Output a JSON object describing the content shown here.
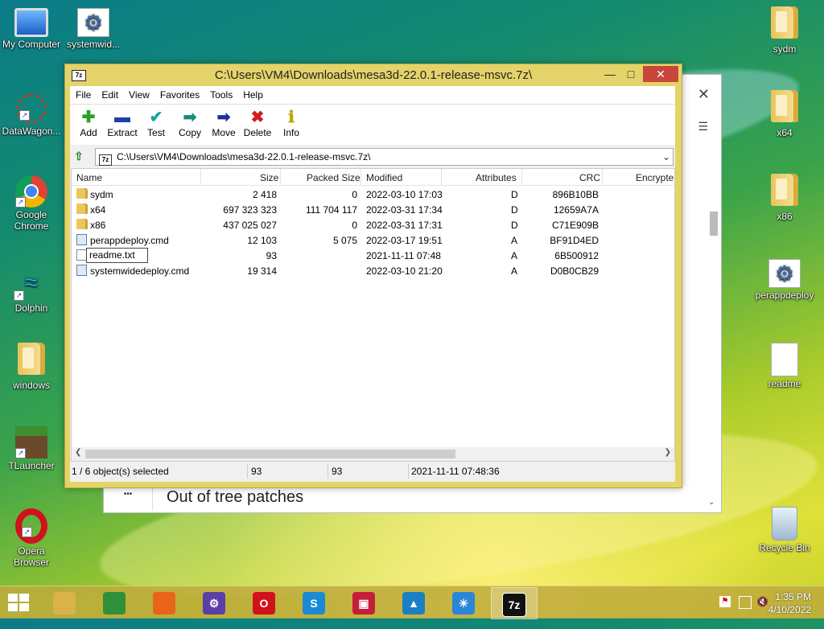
{
  "desktop": {
    "icons_left": [
      {
        "label": "My Computer",
        "icon": "computer-icon"
      },
      {
        "label": "systemwid...",
        "icon": "settings-file-icon"
      },
      {
        "label": "DataWagon...",
        "icon": "datawagon-icon"
      },
      {
        "label": "Google Chrome",
        "icon": "chrome-icon"
      },
      {
        "label": "Dolphin",
        "icon": "dolphin-icon"
      },
      {
        "label": "windows",
        "icon": "folder-icon"
      },
      {
        "label": "TLauncher",
        "icon": "minecraft-block-icon"
      },
      {
        "label": "Opera Browser",
        "icon": "opera-icon"
      }
    ],
    "icons_right": [
      {
        "label": "sydm",
        "icon": "folder-icon"
      },
      {
        "label": "x64",
        "icon": "folder-icon"
      },
      {
        "label": "x86",
        "icon": "folder-icon"
      },
      {
        "label": "perappdeploy",
        "icon": "settings-file-icon"
      },
      {
        "label": "readme",
        "icon": "text-file-icon"
      },
      {
        "label": "Recycle Bin",
        "icon": "recycle-bin-icon"
      }
    ]
  },
  "background_window": {
    "heading": "Out of tree patches",
    "more_glyph": "•••",
    "close_glyph": "✕",
    "menu_glyph": "☰"
  },
  "window": {
    "title": "C:\\Users\\VM4\\Downloads\\mesa3d-22.0.1-release-msvc.7z\\",
    "icon_label": "7z",
    "menu": [
      "File",
      "Edit",
      "View",
      "Favorites",
      "Tools",
      "Help"
    ],
    "toolbar": [
      {
        "label": "Add",
        "icon": "plus-icon",
        "glyph": "✚",
        "color": "#2aa02a"
      },
      {
        "label": "Extract",
        "icon": "minus-icon",
        "glyph": "▬",
        "color": "#1c3fa8"
      },
      {
        "label": "Test",
        "icon": "check-icon",
        "glyph": "✔",
        "color": "#1aa3a3"
      },
      {
        "label": "Copy",
        "icon": "copy-arrow-icon",
        "glyph": "➡",
        "color": "#1a8a7a"
      },
      {
        "label": "Move",
        "icon": "move-arrow-icon",
        "glyph": "➡",
        "color": "#1c2f9a"
      },
      {
        "label": "Delete",
        "icon": "delete-x-icon",
        "glyph": "✖",
        "color": "#d01e1e"
      },
      {
        "label": "Info",
        "icon": "info-icon",
        "glyph": "ℹ",
        "color": "#b8a800"
      }
    ],
    "address": "C:\\Users\\VM4\\Downloads\\mesa3d-22.0.1-release-msvc.7z\\",
    "columns": [
      "Name",
      "Size",
      "Packed Size",
      "Modified",
      "Attributes",
      "CRC",
      "Encrypte"
    ],
    "rows": [
      {
        "name": "sydm",
        "size": "2 418",
        "packed": "0",
        "modified": "2022-03-10 17:03",
        "attr": "D",
        "crc": "896B10BB",
        "type": "folder"
      },
      {
        "name": "x64",
        "size": "697 323 323",
        "packed": "111 704 117",
        "modified": "2022-03-31 17:34",
        "attr": "D",
        "crc": "12659A7A",
        "type": "folder"
      },
      {
        "name": "x86",
        "size": "437 025 027",
        "packed": "0",
        "modified": "2022-03-31 17:31",
        "attr": "D",
        "crc": "C71E909B",
        "type": "folder"
      },
      {
        "name": "perappdeploy.cmd",
        "size": "12 103",
        "packed": "5 075",
        "modified": "2022-03-17 19:51",
        "attr": "A",
        "crc": "BF91D4ED",
        "type": "cmd"
      },
      {
        "name": "readme.txt",
        "size": "93",
        "packed": "",
        "modified": "2021-11-11 07:48",
        "attr": "A",
        "crc": "6B500912",
        "type": "txt"
      },
      {
        "name": "systemwidedeploy.cmd",
        "size": "19 314",
        "packed": "",
        "modified": "2022-03-10 21:20",
        "attr": "A",
        "crc": "D0B0CB29",
        "type": "cmd"
      }
    ],
    "status": {
      "selection": "1 / 6 object(s) selected",
      "size": "93",
      "packed": "93",
      "modified": "2021-11-11 07:48:36"
    }
  },
  "taskbar": {
    "apps": [
      {
        "name": "file-explorer-icon",
        "glyph": "",
        "color": "#d9b24a"
      },
      {
        "name": "chrome-icon",
        "glyph": "",
        "color": "#2f8f3a"
      },
      {
        "name": "firefox-icon",
        "glyph": "",
        "color": "#e8641b"
      },
      {
        "name": "settings-icon",
        "glyph": "⚙",
        "color": "#5b3fa6"
      },
      {
        "name": "opera-icon",
        "glyph": "O",
        "color": "#d0121c"
      },
      {
        "name": "skype-icon",
        "glyph": "S",
        "color": "#1a8ad6"
      },
      {
        "name": "media-icon",
        "glyph": "▣",
        "color": "#c41e3a"
      },
      {
        "name": "photos-icon",
        "glyph": "▲",
        "color": "#1c7fc4"
      },
      {
        "name": "weather-icon",
        "glyph": "☀",
        "color": "#2a86d8"
      },
      {
        "name": "7zip-icon",
        "glyph": "7z",
        "color": "#111111"
      }
    ],
    "time": "1:35 PM",
    "date": "4/10/2022"
  }
}
